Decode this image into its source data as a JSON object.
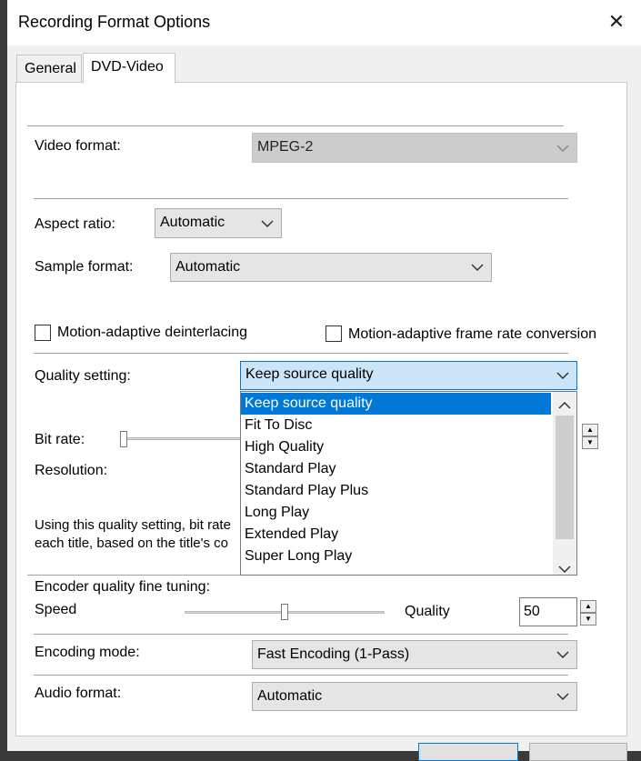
{
  "window": {
    "title": "Recording Format Options",
    "close_glyph": "✕"
  },
  "tabs": [
    {
      "label": "General"
    },
    {
      "label": "DVD-Video"
    }
  ],
  "video_format": {
    "label": "Video format:",
    "value": "MPEG-2"
  },
  "aspect_ratio": {
    "label": "Aspect ratio:",
    "value": "Automatic"
  },
  "sample_format": {
    "label": "Sample format:",
    "value": "Automatic"
  },
  "options": {
    "deinterlacing": {
      "label": "Motion-adaptive deinterlacing",
      "checked": false
    },
    "frame_rate": {
      "label": "Motion-adaptive frame rate conversion",
      "checked": false
    }
  },
  "quality": {
    "label": "Quality setting:",
    "value": "Keep source quality",
    "options": [
      "Keep source quality",
      "Fit To Disc",
      "High Quality",
      "Standard Play",
      "Standard Play Plus",
      "Long Play",
      "Extended Play",
      "Super Long Play"
    ],
    "selected_index": 0
  },
  "bit_rate": {
    "label": "Bit rate:"
  },
  "resolution": {
    "label": "Resolution:"
  },
  "description": {
    "line1": "Using this quality setting, bit rate",
    "line2": "each title, based on the title's co"
  },
  "encoder": {
    "label": "Encoder quality fine tuning:",
    "speed_label": "Speed",
    "quality_label": "Quality",
    "value": "50",
    "slider_level": 0.5
  },
  "encoding_mode": {
    "label": "Encoding mode:",
    "value": "Fast Encoding (1-Pass)"
  },
  "audio_format": {
    "label": "Audio format:",
    "value": "Automatic"
  },
  "colors": {
    "accent": "#0078d7",
    "highlight": "#cce4f7"
  }
}
